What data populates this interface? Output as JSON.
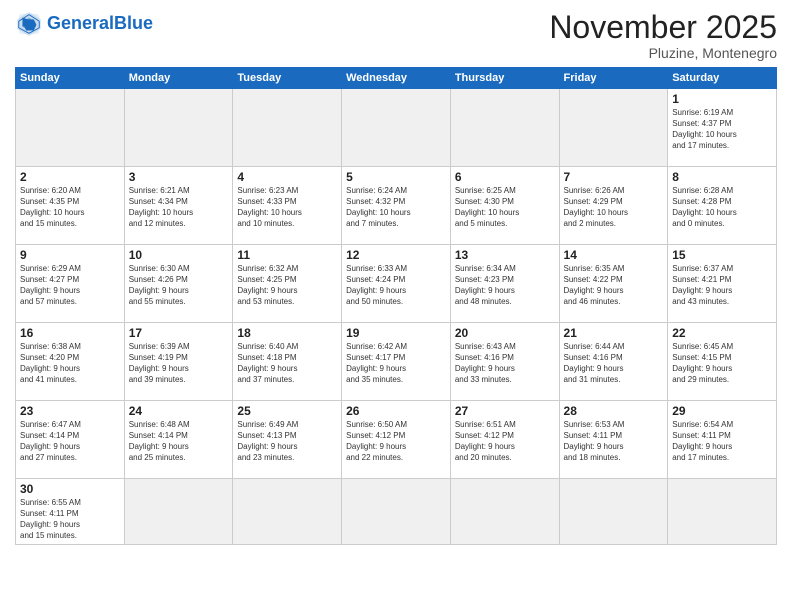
{
  "header": {
    "logo_general": "General",
    "logo_blue": "Blue",
    "month_title": "November 2025",
    "location": "Pluzine, Montenegro"
  },
  "weekdays": [
    "Sunday",
    "Monday",
    "Tuesday",
    "Wednesday",
    "Thursday",
    "Friday",
    "Saturday"
  ],
  "weeks": [
    [
      {
        "day": "",
        "info": "",
        "empty": true
      },
      {
        "day": "",
        "info": "",
        "empty": true
      },
      {
        "day": "",
        "info": "",
        "empty": true
      },
      {
        "day": "",
        "info": "",
        "empty": true
      },
      {
        "day": "",
        "info": "",
        "empty": true
      },
      {
        "day": "",
        "info": "",
        "empty": true
      },
      {
        "day": "1",
        "info": "Sunrise: 6:19 AM\nSunset: 4:37 PM\nDaylight: 10 hours\nand 17 minutes."
      }
    ],
    [
      {
        "day": "2",
        "info": "Sunrise: 6:20 AM\nSunset: 4:35 PM\nDaylight: 10 hours\nand 15 minutes."
      },
      {
        "day": "3",
        "info": "Sunrise: 6:21 AM\nSunset: 4:34 PM\nDaylight: 10 hours\nand 12 minutes."
      },
      {
        "day": "4",
        "info": "Sunrise: 6:23 AM\nSunset: 4:33 PM\nDaylight: 10 hours\nand 10 minutes."
      },
      {
        "day": "5",
        "info": "Sunrise: 6:24 AM\nSunset: 4:32 PM\nDaylight: 10 hours\nand 7 minutes."
      },
      {
        "day": "6",
        "info": "Sunrise: 6:25 AM\nSunset: 4:30 PM\nDaylight: 10 hours\nand 5 minutes."
      },
      {
        "day": "7",
        "info": "Sunrise: 6:26 AM\nSunset: 4:29 PM\nDaylight: 10 hours\nand 2 minutes."
      },
      {
        "day": "8",
        "info": "Sunrise: 6:28 AM\nSunset: 4:28 PM\nDaylight: 10 hours\nand 0 minutes."
      }
    ],
    [
      {
        "day": "9",
        "info": "Sunrise: 6:29 AM\nSunset: 4:27 PM\nDaylight: 9 hours\nand 57 minutes."
      },
      {
        "day": "10",
        "info": "Sunrise: 6:30 AM\nSunset: 4:26 PM\nDaylight: 9 hours\nand 55 minutes."
      },
      {
        "day": "11",
        "info": "Sunrise: 6:32 AM\nSunset: 4:25 PM\nDaylight: 9 hours\nand 53 minutes."
      },
      {
        "day": "12",
        "info": "Sunrise: 6:33 AM\nSunset: 4:24 PM\nDaylight: 9 hours\nand 50 minutes."
      },
      {
        "day": "13",
        "info": "Sunrise: 6:34 AM\nSunset: 4:23 PM\nDaylight: 9 hours\nand 48 minutes."
      },
      {
        "day": "14",
        "info": "Sunrise: 6:35 AM\nSunset: 4:22 PM\nDaylight: 9 hours\nand 46 minutes."
      },
      {
        "day": "15",
        "info": "Sunrise: 6:37 AM\nSunset: 4:21 PM\nDaylight: 9 hours\nand 43 minutes."
      }
    ],
    [
      {
        "day": "16",
        "info": "Sunrise: 6:38 AM\nSunset: 4:20 PM\nDaylight: 9 hours\nand 41 minutes."
      },
      {
        "day": "17",
        "info": "Sunrise: 6:39 AM\nSunset: 4:19 PM\nDaylight: 9 hours\nand 39 minutes."
      },
      {
        "day": "18",
        "info": "Sunrise: 6:40 AM\nSunset: 4:18 PM\nDaylight: 9 hours\nand 37 minutes."
      },
      {
        "day": "19",
        "info": "Sunrise: 6:42 AM\nSunset: 4:17 PM\nDaylight: 9 hours\nand 35 minutes."
      },
      {
        "day": "20",
        "info": "Sunrise: 6:43 AM\nSunset: 4:16 PM\nDaylight: 9 hours\nand 33 minutes."
      },
      {
        "day": "21",
        "info": "Sunrise: 6:44 AM\nSunset: 4:16 PM\nDaylight: 9 hours\nand 31 minutes."
      },
      {
        "day": "22",
        "info": "Sunrise: 6:45 AM\nSunset: 4:15 PM\nDaylight: 9 hours\nand 29 minutes."
      }
    ],
    [
      {
        "day": "23",
        "info": "Sunrise: 6:47 AM\nSunset: 4:14 PM\nDaylight: 9 hours\nand 27 minutes."
      },
      {
        "day": "24",
        "info": "Sunrise: 6:48 AM\nSunset: 4:14 PM\nDaylight: 9 hours\nand 25 minutes."
      },
      {
        "day": "25",
        "info": "Sunrise: 6:49 AM\nSunset: 4:13 PM\nDaylight: 9 hours\nand 23 minutes."
      },
      {
        "day": "26",
        "info": "Sunrise: 6:50 AM\nSunset: 4:12 PM\nDaylight: 9 hours\nand 22 minutes."
      },
      {
        "day": "27",
        "info": "Sunrise: 6:51 AM\nSunset: 4:12 PM\nDaylight: 9 hours\nand 20 minutes."
      },
      {
        "day": "28",
        "info": "Sunrise: 6:53 AM\nSunset: 4:11 PM\nDaylight: 9 hours\nand 18 minutes."
      },
      {
        "day": "29",
        "info": "Sunrise: 6:54 AM\nSunset: 4:11 PM\nDaylight: 9 hours\nand 17 minutes."
      }
    ],
    [
      {
        "day": "30",
        "info": "Sunrise: 6:55 AM\nSunset: 4:11 PM\nDaylight: 9 hours\nand 15 minutes."
      },
      {
        "day": "",
        "info": "",
        "empty": true
      },
      {
        "day": "",
        "info": "",
        "empty": true
      },
      {
        "day": "",
        "info": "",
        "empty": true
      },
      {
        "day": "",
        "info": "",
        "empty": true
      },
      {
        "day": "",
        "info": "",
        "empty": true
      },
      {
        "day": "",
        "info": "",
        "empty": true
      }
    ]
  ]
}
